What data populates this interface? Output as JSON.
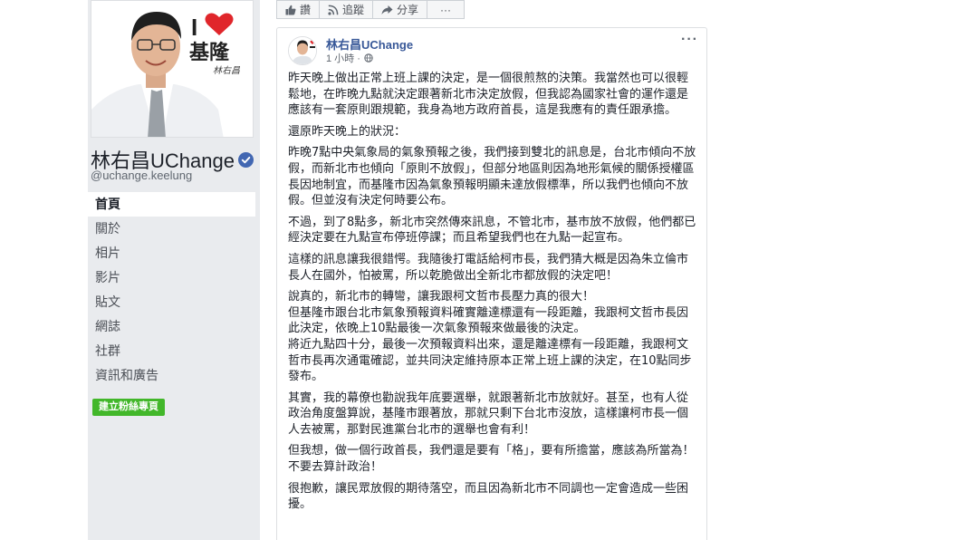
{
  "page": {
    "name": "林右昌UChange",
    "handle": "@uchange.keelung",
    "cover_text": {
      "line1": "I",
      "line2": "基隆",
      "signature": "林右昌"
    }
  },
  "nav": {
    "items": [
      {
        "label": "首頁",
        "active": true
      },
      {
        "label": "關於"
      },
      {
        "label": "相片"
      },
      {
        "label": "影片"
      },
      {
        "label": "貼文"
      },
      {
        "label": "網誌"
      },
      {
        "label": "社群"
      },
      {
        "label": "資訊和廣告"
      }
    ],
    "create_button": "建立粉絲專頁"
  },
  "actions": {
    "like": "讚",
    "follow": "追蹤",
    "share": "分享",
    "more": "···"
  },
  "post": {
    "author": "林右昌UChange",
    "time": "1 小時 ·",
    "more": "···",
    "paragraphs": [
      "昨天晚上做出正常上班上課的決定，是一個很煎熬的決策。我當然也可以很輕鬆地，在昨晚九點就決定跟著新北市決定放假，但我認為國家社會的運作還是應該有一套原則跟規範，我身為地方政府首長，這是我應有的責任跟承擔。",
      "還原昨天晚上的狀況：",
      "昨晚7點中央氣象局的氣象預報之後，我們接到雙北的訊息是，台北市傾向不放假，而新北市也傾向「原則不放假」，但部分地區則因為地形氣候的關係授權區長因地制宜，而基隆市因為氣象預報明顯未達放假標準，所以我們也傾向不放假。但並沒有決定何時要公布。",
      "不過，到了8點多，新北市突然傳來訊息，不管北市，基市放不放假，他們都已經決定要在九點宣布停班停課；而且希望我們也在九點一起宣布。",
      "這樣的訊息讓我很錯愕。我隨後打電話給柯市長，我們猜大概是因為朱立倫市長人在國外，怕被罵，所以乾脆做出全新北市都放假的決定吧！",
      "說真的，新北市的轉彎，讓我跟柯文哲市長壓力真的很大！\n但基隆市跟台北市氣象預報資料確實離達標還有一段距離，我跟柯文哲市長因此決定，依晚上10點最後一次氣象預報來做最後的決定。\n將近九點四十分，最後一次預報資料出來，還是離達標有一段距離，我跟柯文哲市長再次通電確認，並共同決定維持原本正常上班上課的決定，在10點同步發布。",
      "其實，我的幕僚也勸說我年底要選舉，就跟著新北市放就好。甚至，也有人從政治角度盤算說，基隆市跟著放，那就只剩下台北市沒放，這樣讓柯市長一個人去被罵，那對民進黨台北市的選舉也會有利！",
      "但我想，做一個行政首長，我們還是要有「格」，要有所擔當，應該為所當為！不要去算計政治！",
      "很抱歉，讓民眾放假的期待落空，而且因為新北市不同調也一定會造成一些困擾。"
    ]
  },
  "colors": {
    "link_blue": "#385898",
    "verified_blue": "#4267b2",
    "button_green": "#42b72a",
    "sidebar_bg": "#e9ebee",
    "heart_red": "#e0262b"
  }
}
